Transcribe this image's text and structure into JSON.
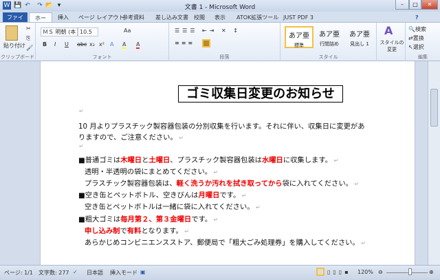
{
  "window": {
    "title": "文書 1 - Microsoft Word",
    "minimize": "–",
    "maximize": "□",
    "close": "✕"
  },
  "qat": [
    "W",
    "💾",
    "↶",
    "↷",
    "📂",
    "▾"
  ],
  "tabs": [
    "ファイル",
    "ホーム",
    "挿入",
    "ページ レイアウト",
    "参考資料",
    "差し込み文書",
    "校閲",
    "表示",
    "ATOK拡張ツール",
    "JUST PDF 3"
  ],
  "ribbon": {
    "clipboard": {
      "paste": "貼り付け",
      "label": "クリップボード"
    },
    "font": {
      "name": "ＭＳ 明朝 (本",
      "size": "10.5",
      "label": "フォント",
      "buttons": [
        "B",
        "I",
        "U",
        "abc",
        "x₂",
        "x²",
        "A",
        "A",
        "A",
        "Aa"
      ]
    },
    "paragraph": {
      "label": "段落"
    },
    "styles": {
      "items": [
        {
          "preview": "あア亜",
          "name": "標準"
        },
        {
          "preview": "あア亜",
          "name": "行間詰め"
        },
        {
          "preview": "あア亜",
          "name": "見出し 1"
        }
      ],
      "change": "スタイルの変更",
      "label": "スタイル"
    },
    "editing": {
      "search": "検索",
      "replace": "置換",
      "select": "選択",
      "label": "編集"
    }
  },
  "document": {
    "title": "ゴミ収集日変更のお知らせ",
    "lines": [
      [
        {
          "t": "10 月よりプラスチック製容器包装の分別収集を行います。それに伴い、収集日に変更があ"
        }
      ],
      [
        {
          "t": "りますので、ご注意ください。"
        }
      ],
      [
        {
          "t": "■普通ゴミは"
        },
        {
          "t": "木曜日",
          "r": 1
        },
        {
          "t": "と"
        },
        {
          "t": "土曜日",
          "r": 1
        },
        {
          "t": "、プラスチック製容器包装は"
        },
        {
          "t": "水曜日",
          "r": 1
        },
        {
          "t": "に収集します。"
        }
      ],
      [
        {
          "t": "透明・半透明の袋にまとめてください。"
        }
      ],
      [
        {
          "t": "プラスチック製容器包装は、"
        },
        {
          "t": "軽く洗うか汚れを拭き取ってから",
          "r": 1
        },
        {
          "t": "袋に入れてください。"
        }
      ],
      [
        {
          "t": "■空き缶とペットボトル、空きびんは"
        },
        {
          "t": "月曜日",
          "r": 1
        },
        {
          "t": "です。"
        }
      ],
      [
        {
          "t": "空き缶とペットボトルは一緒に袋に入れてください。"
        }
      ],
      [
        {
          "t": "■粗大ゴミは"
        },
        {
          "t": "毎月第２、第３金曜日",
          "r": 1
        },
        {
          "t": "です。"
        }
      ],
      [
        {
          "t": "申し込み制",
          "r": 1
        },
        {
          "t": "で"
        },
        {
          "t": "有料",
          "r": 1
        },
        {
          "t": "となります。"
        }
      ],
      [
        {
          "t": "あらかじめコンビニエンスストア、郵便局で「粗大ごみ処理券」を購入してください。"
        }
      ]
    ]
  },
  "status": {
    "page": "ページ: 1/1",
    "words": "文字数: 277",
    "language": "日本語",
    "mode": "挿入モード",
    "zoom": "120%"
  }
}
